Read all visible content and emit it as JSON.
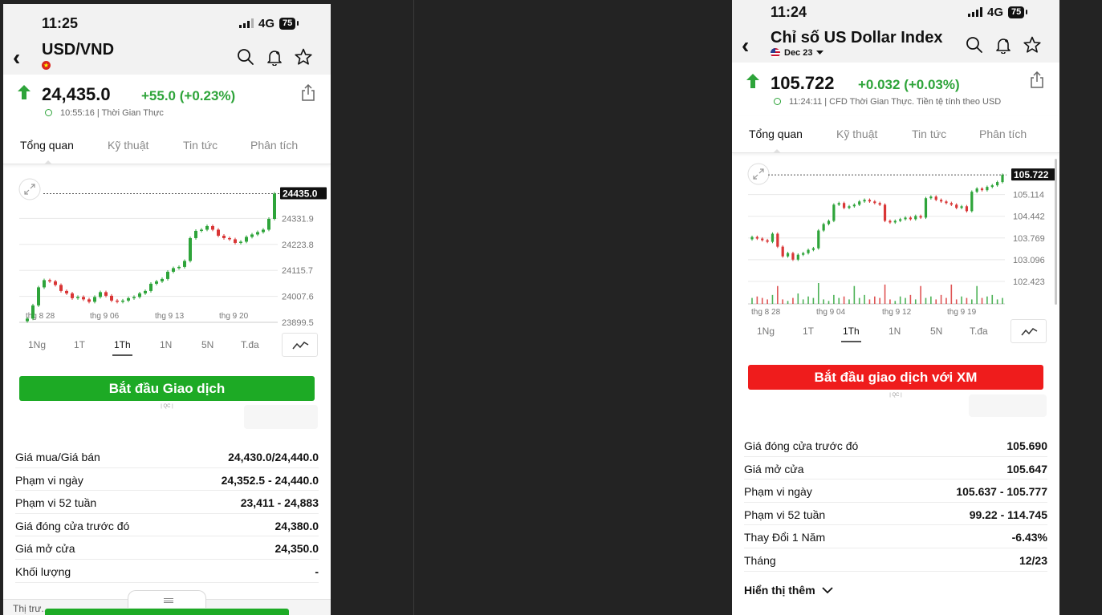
{
  "left": {
    "status": {
      "time": "11:25",
      "network": "4G",
      "battery": "75"
    },
    "header": {
      "title": "USD/VND"
    },
    "quote": {
      "price": "24,435.0",
      "change": "+55.0 (+0.23%)",
      "timestamp": "10:55:16 | Thời Gian Thực"
    },
    "tabs": [
      "Tổng quan",
      "Kỹ thuật",
      "Tin tức",
      "Phân tích"
    ],
    "ranges": [
      "1Ng",
      "1T",
      "1Th",
      "1N",
      "5N",
      "T.đa"
    ],
    "cta": "Bắt đầu Giao dịch",
    "ad_label": "| QC |",
    "stats": [
      {
        "label": "Giá mua/Giá bán",
        "value": "24,430.0/24,440.0"
      },
      {
        "label": "Phạm vi ngày",
        "value": "24,352.5 - 24,440.0"
      },
      {
        "label": "Phạm vi 52 tuần",
        "value": "23,411 - 24,883"
      },
      {
        "label": "Giá đóng cửa trước đó",
        "value": "24,380.0"
      },
      {
        "label": "Giá mở cửa",
        "value": "24,350.0"
      },
      {
        "label": "Khối lượng",
        "value": "-"
      }
    ],
    "bottom_text": "Thị trư..."
  },
  "right": {
    "status": {
      "time": "11:24",
      "network": "4G",
      "battery": "75"
    },
    "header": {
      "title": "Chỉ số US Dollar Index",
      "contract": "Dec 23"
    },
    "quote": {
      "price": "105.722",
      "change": "+0.032 (+0.03%)",
      "timestamp": "11:24:11 | CFD Thời Gian Thực. Tiền tệ tính theo USD"
    },
    "tabs": [
      "Tổng quan",
      "Kỹ thuật",
      "Tin tức",
      "Phân tích"
    ],
    "ranges": [
      "1Ng",
      "1T",
      "1Th",
      "1N",
      "5N",
      "T.đa"
    ],
    "cta": "Bắt đầu giao dịch với XM",
    "ad_label": "| QC |",
    "stats": [
      {
        "label": "Giá đóng cửa trước đó",
        "value": "105.690"
      },
      {
        "label": "Giá mở cửa",
        "value": "105.647"
      },
      {
        "label": "Phạm vi ngày",
        "value": "105.637 - 105.777"
      },
      {
        "label": "Phạm vi 52 tuần",
        "value": "99.22 - 114.745"
      },
      {
        "label": "Thay Đổi 1 Năm",
        "value": "-6.43%"
      },
      {
        "label": "Tháng",
        "value": "12/23"
      }
    ],
    "show_more": "Hiển thị thêm"
  },
  "colors": {
    "up": "#2ea43a",
    "down": "#d93636",
    "cta_green": "#1daa25",
    "cta_red": "#ef1c1c"
  },
  "chart_data": [
    {
      "type": "candlestick",
      "name": "USD/VND",
      "x_ticks": [
        "thg 8 28",
        "thg 9 06",
        "thg 9 13",
        "thg 9 20"
      ],
      "y_ticks": [
        24331.9,
        24223.8,
        24115.7,
        24007.6,
        23899.5
      ],
      "last": 24435.0,
      "ylim": [
        23899.5,
        24440
      ],
      "closes": [
        23915,
        23970,
        24045,
        24075,
        24070,
        24055,
        24030,
        24020,
        24000,
        24005,
        23995,
        23985,
        24005,
        24025,
        24010,
        23990,
        23985,
        23990,
        24000,
        24005,
        24020,
        24030,
        24060,
        24070,
        24080,
        24110,
        24125,
        24130,
        24155,
        24250,
        24280,
        24285,
        24300,
        24285,
        24260,
        24250,
        24245,
        24230,
        24235,
        24255,
        24265,
        24275,
        24285,
        24330,
        24435
      ]
    },
    {
      "type": "candlestick",
      "name": "Chỉ số US Dollar Index",
      "x_ticks": [
        "thg 8 28",
        "thg 9 04",
        "thg 9 12",
        "thg 9 19"
      ],
      "y_ticks": [
        105.114,
        104.442,
        103.769,
        103.096,
        102.423
      ],
      "last": 105.722,
      "ylim": [
        102.2,
        105.75
      ],
      "closes": [
        103.8,
        103.75,
        103.7,
        103.65,
        103.9,
        103.5,
        103.2,
        103.3,
        103.1,
        103.25,
        103.3,
        103.4,
        103.45,
        104.0,
        104.2,
        104.3,
        104.8,
        104.85,
        104.7,
        104.75,
        104.8,
        104.9,
        104.95,
        104.9,
        104.85,
        104.8,
        104.3,
        104.25,
        104.3,
        104.35,
        104.4,
        104.35,
        104.45,
        104.4,
        105.0,
        105.05,
        104.95,
        104.9,
        104.85,
        104.8,
        104.7,
        104.75,
        104.6,
        105.2,
        105.3,
        105.25,
        105.35,
        105.4,
        105.5,
        105.722
      ],
      "volumes": [
        4,
        5,
        4,
        3,
        6,
        12,
        3,
        2,
        4,
        7,
        3,
        5,
        4,
        14,
        3,
        2,
        6,
        4,
        5,
        3,
        12,
        4,
        6,
        3,
        5,
        4,
        13,
        3,
        2,
        5,
        4,
        6,
        3,
        12,
        4,
        5,
        3,
        6,
        4,
        13,
        3,
        5,
        4,
        3,
        12,
        4,
        5,
        6,
        3,
        4
      ]
    }
  ]
}
